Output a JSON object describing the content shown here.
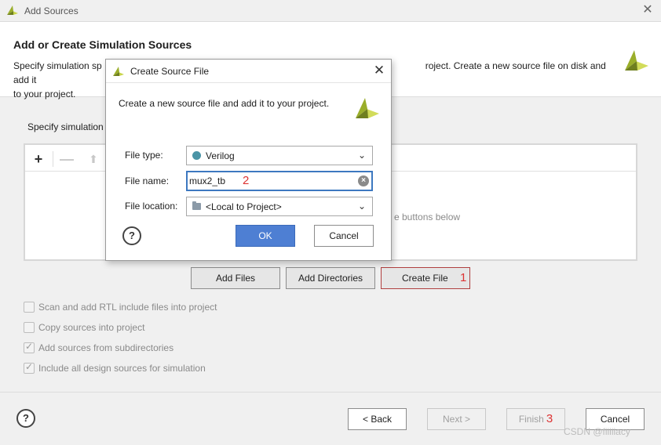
{
  "window": {
    "title": "Add Sources",
    "close_glyph": "✕"
  },
  "header": {
    "title": "Add or Create Simulation Sources",
    "description_before": "Specify simulation sp",
    "description_after": "roject. Create a new source file on disk and add it",
    "description_line2": "to your project."
  },
  "main": {
    "specify_label": "Specify simulation",
    "hint_text": "e buttons below",
    "toolbar": {
      "add_glyph": "+",
      "remove_glyph": "—",
      "up_glyph": "⬆"
    },
    "buttons": {
      "add_files": "Add Files",
      "add_directories": "Add Directories",
      "create_file": "Create File"
    },
    "marker_1": "1",
    "options": [
      {
        "label": "Scan and add RTL include files into project",
        "checked": false
      },
      {
        "label": "Copy sources into project",
        "checked": false
      },
      {
        "label": "Add sources from subdirectories",
        "checked": true
      },
      {
        "label": "Include all design sources for simulation",
        "checked": true
      }
    ]
  },
  "footer": {
    "help": "?",
    "back": "< Back",
    "next": "Next >",
    "finish": "Finish",
    "marker_3": "3",
    "cancel": "Cancel"
  },
  "dialog": {
    "title": "Create Source File",
    "close_glyph": "✕",
    "description": "Create a new source file and add it to your project.",
    "file_type_label": "File type:",
    "file_type_value": "Verilog",
    "file_name_label": "File name:",
    "file_name_value": "mux2_tb",
    "marker_2": "2",
    "file_location_label": "File location:",
    "file_location_value": "<Local to Project>",
    "help": "?",
    "ok": "OK",
    "cancel": "Cancel",
    "chevron_glyph": "⌄",
    "clear_glyph": "×"
  },
  "watermark": "CSDN @fiiiiiacy",
  "colors": {
    "accent": "#4e7fd3",
    "brand": "#b5c43a",
    "marker_red": "#dd3333"
  }
}
